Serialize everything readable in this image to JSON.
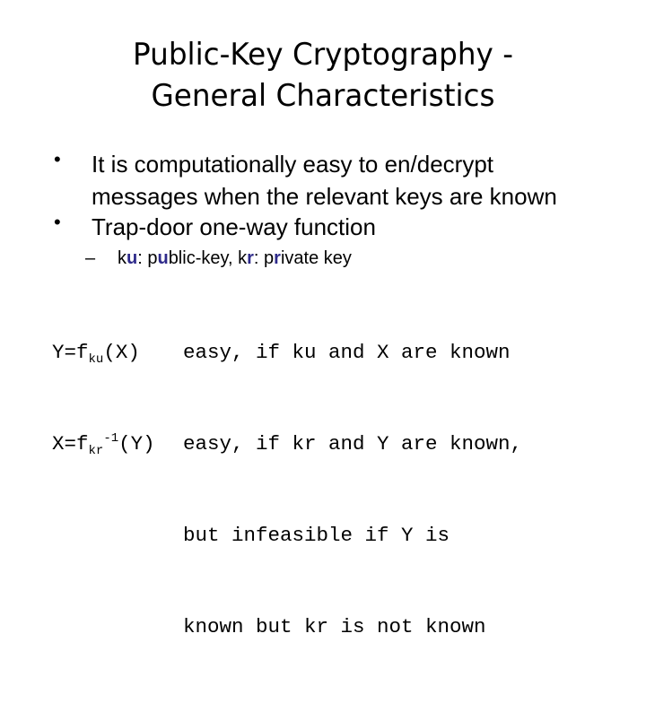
{
  "slide": {
    "title_line1": "Public-Key Cryptography -",
    "title_line2": "General Characteristics",
    "bullets": [
      {
        "symbol": "•",
        "line1": "It is computationally easy to en/decrypt",
        "line2": "messages when the relevant keys are known"
      },
      {
        "symbol": "•",
        "line1": "Trap-door one-way function"
      }
    ],
    "sub_bullet": {
      "dash": "–",
      "parts": [
        "k",
        "u",
        ": p",
        "u",
        "blic-key, k",
        "r",
        ": p",
        "r",
        "ivate key"
      ],
      "highlight_color": "#2e2a8a"
    },
    "formulas": {
      "row1": {
        "lhs": "Y=f",
        "sub": "ku",
        "arg": "(X)",
        "text": "easy, if ku and X are known"
      },
      "row2": {
        "lhs": "X=f",
        "sub": "kr",
        "sup": "-1",
        "arg": "(Y)",
        "text": "easy, if kr and Y are known,"
      },
      "row3": "but infeasible if Y is",
      "row4": "known but kr is not known"
    }
  }
}
